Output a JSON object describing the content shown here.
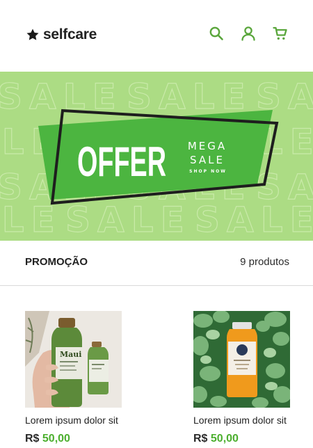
{
  "header": {
    "brand": "selfcare",
    "icons": [
      "search-icon",
      "user-icon",
      "cart-icon"
    ]
  },
  "banner": {
    "background_word": "SALE",
    "headline": "OFFER",
    "sub_1": "MEGA",
    "sub_2": "SALE",
    "cta": "SHOP NOW",
    "colors": {
      "bg": "#acdc84",
      "panel": "#4cb540",
      "frame": "#1e1e1e"
    }
  },
  "section": {
    "title": "PROMOÇÃO",
    "count": "9 produtos"
  },
  "products": [
    {
      "name": "Lorem ipsum dolor sit",
      "currency": "R$",
      "price": "50,00",
      "image": "shampoo-bottles-photo"
    },
    {
      "name": "Lorem ipsum dolor sit",
      "currency": "R$",
      "price": "50,00",
      "image": "juice-bottle-photo"
    }
  ],
  "colors": {
    "accent": "#4caf2f"
  }
}
